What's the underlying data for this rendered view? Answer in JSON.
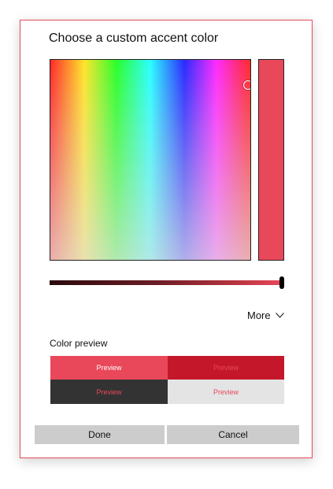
{
  "dialog": {
    "title": "Choose a custom accent color",
    "accent_color": "#e8485a",
    "more_label": "More",
    "more_icon": "chevron-down-icon",
    "preview_label": "Color preview",
    "previews": [
      {
        "text": "Preview",
        "bg": "#e8485a",
        "fg": "#ffffff"
      },
      {
        "text": "Preview",
        "bg": "#c4182a",
        "fg": "#e8485a"
      },
      {
        "text": "Preview",
        "bg": "#333333",
        "fg": "#e8485a"
      },
      {
        "text": "Preview",
        "bg": "#e4e4e4",
        "fg": "#e8485a"
      }
    ],
    "brightness_level": 1.0,
    "done_label": "Done",
    "cancel_label": "Cancel"
  }
}
